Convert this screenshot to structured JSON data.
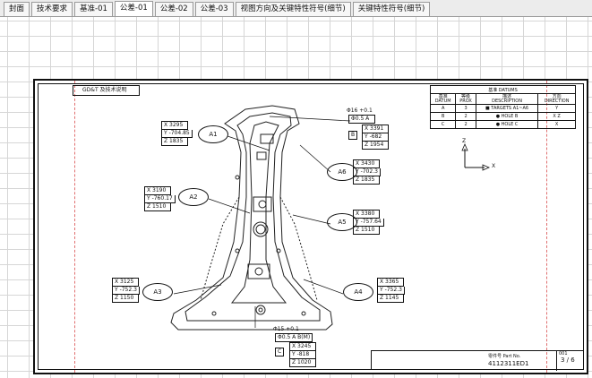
{
  "tabs": [
    {
      "label": "封面"
    },
    {
      "label": "技术要求"
    },
    {
      "label": "基准-01"
    },
    {
      "label": "公差-01"
    },
    {
      "label": "公差-02"
    },
    {
      "label": "公差-03"
    },
    {
      "label": "视图方向及关键特性符号(细节)"
    },
    {
      "label": "关键特性符号(细节)"
    }
  ],
  "drawing": {
    "title": "GD&T 及技术说明",
    "datum_table": {
      "header": "基准 DATUMS",
      "columns": [
        "基准\nDATUM",
        "等级\nPROX",
        "描述\nDESCRIPTION",
        "方向\nDIRECTION"
      ],
      "rows": [
        {
          "datum": "A",
          "prox": "3",
          "desc": "■ TARGETS A1~A6",
          "dir": "Y"
        },
        {
          "datum": "B",
          "prox": "2",
          "desc": "● HOLE B",
          "dir": "X Z"
        },
        {
          "datum": "C",
          "prox": "2",
          "desc": "● HOLE C",
          "dir": "X"
        }
      ]
    },
    "axes": {
      "z": "Z",
      "x": "X"
    },
    "targets": [
      {
        "id": "A1",
        "x": "X 3295",
        "y": "Y -704.85",
        "z": "Z 1835"
      },
      {
        "id": "A2",
        "x": "X 3190",
        "y": "Y -760.17",
        "z": "Z 1510"
      },
      {
        "id": "A3",
        "x": "X 3125",
        "y": "Y -752.3",
        "z": "Z 1150"
      },
      {
        "id": "A4",
        "x": "X 3365",
        "y": "Y -752.3",
        "z": "Z 1145"
      },
      {
        "id": "A5",
        "x": "X 3380",
        "y": "Y -757.64",
        "z": "Z 1510"
      },
      {
        "id": "A6",
        "x": "X 3430",
        "y": "Y -702.3",
        "z": "Z 1835"
      }
    ],
    "hole_b": {
      "size": "Φ16 +0.1",
      "fcf": "Φ0.5 A",
      "label": "B",
      "x": "X 3391",
      "y": "Y -682",
      "z": "Z 1954"
    },
    "hole_c": {
      "size": "Φ15 +0.1",
      "fcf": "Φ0.5 A B(M)",
      "label": "C",
      "x": "X 3245",
      "y": "Y -818",
      "z": "Z 1020"
    },
    "titleblock": {
      "part_label": "零件号 Part No.",
      "part_no": "4112311ED1",
      "sheet_label": "图 No.",
      "sheet": "3 / 6",
      "sheet_no": "001"
    }
  }
}
